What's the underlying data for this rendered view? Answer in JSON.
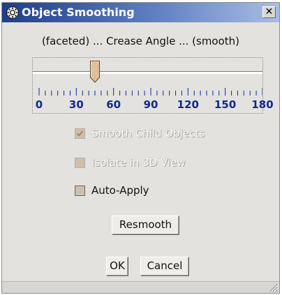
{
  "dialog": {
    "title": "Object Smoothing",
    "close_glyph": "✕",
    "icon": "gear-icon"
  },
  "slider": {
    "header": "(faceted) ... Crease Angle ... (smooth)",
    "min": 0,
    "max": 180,
    "value": 45,
    "tick_labels": [
      "0",
      "30",
      "60",
      "90",
      "120",
      "150",
      "180"
    ]
  },
  "options": {
    "smooth_child": {
      "label": "Smooth Child Objects",
      "checked": true,
      "enabled": false
    },
    "isolate_3d": {
      "label": "Isolate in 3D View",
      "checked": false,
      "enabled": false
    },
    "auto_apply": {
      "label": "Auto-Apply",
      "checked": false,
      "enabled": true
    }
  },
  "buttons": {
    "resmooth": "Resmooth",
    "ok": "OK",
    "cancel": "Cancel"
  },
  "colors": {
    "title_start": "#1d3e8a",
    "title_end": "#a9bde4",
    "tick_label": "#0f2a8f"
  }
}
